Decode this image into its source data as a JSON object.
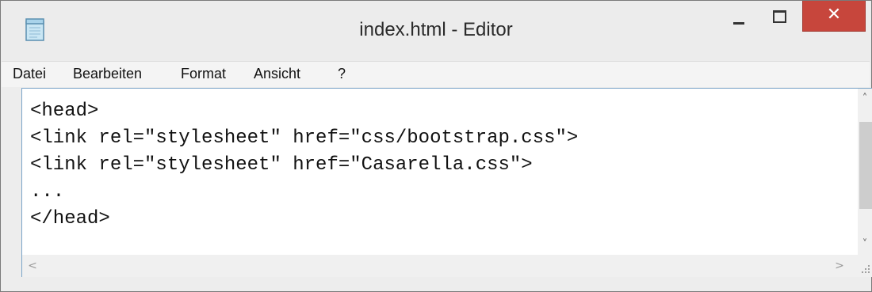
{
  "window": {
    "title": "index.html - Editor",
    "close_glyph": "✕",
    "minimize_icon": "minimize-icon",
    "maximize_icon": "maximize-icon",
    "app_icon": "notepad-icon",
    "close_color": "#c7463c"
  },
  "menu": {
    "items": [
      "Datei",
      "Bearbeiten",
      "Format",
      "Ansicht",
      "?"
    ]
  },
  "editor": {
    "lines": [
      "<head>",
      "<link rel=\"stylesheet\" href=\"css/bootstrap.css\">",
      "<link rel=\"stylesheet\" href=\"Casarella.css\">",
      "...",
      "</head>"
    ]
  },
  "scrollbars": {
    "up_glyph": "˄",
    "down_glyph": "˅",
    "left_glyph": "<",
    "right_glyph": ">"
  }
}
